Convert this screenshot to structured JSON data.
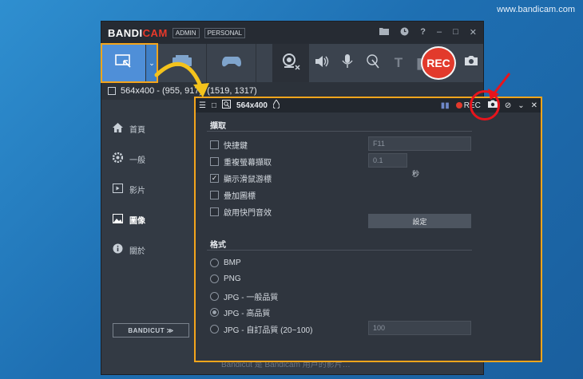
{
  "watermark": "www.bandicam.com",
  "app": {
    "logo_a": "BANDI",
    "logo_b": "CAM",
    "tags": [
      "ADMIN",
      "PERSONAL"
    ],
    "rec_label": "REC",
    "status_text": "564x400 - (955, 917), (1519, 1317)"
  },
  "sidebar": {
    "items": [
      {
        "label": "首頁",
        "icon": "home-icon"
      },
      {
        "label": "一般",
        "icon": "gear-icon"
      },
      {
        "label": "影片",
        "icon": "video-icon"
      },
      {
        "label": "圖像",
        "icon": "image-icon"
      },
      {
        "label": "關於",
        "icon": "info-icon"
      }
    ],
    "selected": "圖像",
    "bandicut_label": "BANDICUT ≫"
  },
  "overlay": {
    "size_label": "564x400",
    "rec_label": "REC",
    "capture": {
      "title": "擷取",
      "hotkey_label": "快捷鍵",
      "hotkey_value": "F11",
      "repeat_label": "重複螢幕擷取",
      "repeat_value": "0.1",
      "repeat_unit": "秒",
      "cursor_label": "顯示滑鼠游標",
      "logo_label": "疊加圖標",
      "shutter_label": "啟用快門音效",
      "settings_button": "設定"
    },
    "format": {
      "title": "格式",
      "options": [
        "BMP",
        "PNG",
        "JPG - 一般品質",
        "JPG - 高品質",
        "JPG - 自訂品質 (20~100)"
      ],
      "selected": "JPG - 高品質",
      "custom_quality_value": "100"
    }
  },
  "footer_text": "Bandicut 是 Bandicam 用戶的影片…",
  "colors": {
    "accent": "#f4a51c",
    "rec": "#e23a2c",
    "annotation": "#e8141c",
    "active_mode": "#4f8fd8"
  }
}
